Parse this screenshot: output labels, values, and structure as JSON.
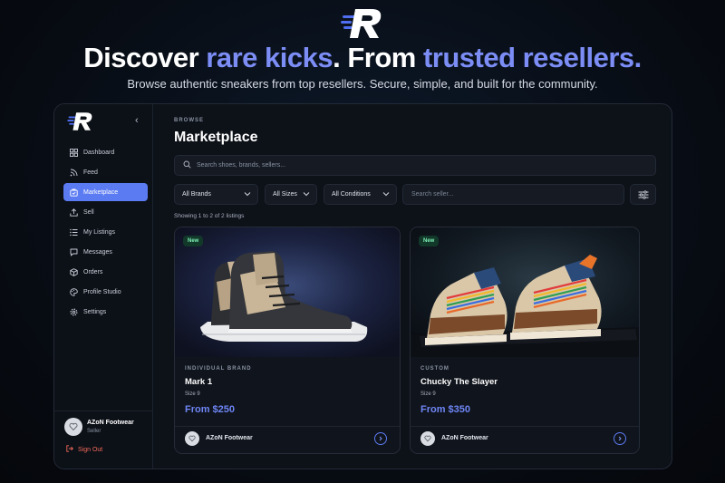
{
  "hero": {
    "title_part1": "Discover ",
    "title_accent1": "rare kicks",
    "title_part2": ". From ",
    "title_accent2": "trusted resellers.",
    "subtitle": "Browse authentic sneakers from top resellers. Secure, simple, and built for the community.",
    "accent_color": "#7c8df6"
  },
  "sidebar": {
    "items": [
      {
        "label": "Dashboard",
        "icon": "grid-icon"
      },
      {
        "label": "Feed",
        "icon": "rss-icon"
      },
      {
        "label": "Marketplace",
        "icon": "shop-icon",
        "active": true
      },
      {
        "label": "Sell",
        "icon": "upload-icon"
      },
      {
        "label": "My Listings",
        "icon": "list-icon"
      },
      {
        "label": "Messages",
        "icon": "chat-icon"
      },
      {
        "label": "Orders",
        "icon": "box-icon"
      },
      {
        "label": "Profile Studio",
        "icon": "palette-icon"
      },
      {
        "label": "Settings",
        "icon": "gear-icon"
      }
    ],
    "user": {
      "name": "AZoN Footwear",
      "role": "Seller"
    },
    "signout_label": "Sign Out"
  },
  "main": {
    "eyebrow": "BROWSE",
    "title": "Marketplace",
    "search_placeholder": "Search shoes, brands, sellers...",
    "filters": {
      "brand": "All Brands",
      "size": "All Sizes",
      "condition": "All Conditions",
      "seller_placeholder": "Search seller..."
    },
    "showing": "Showing 1 to 2 of 2 listings",
    "listings": [
      {
        "badge": "New",
        "category": "INDIVIDUAL BRAND",
        "title": "Mark 1",
        "size": "Size 9",
        "price": "From $250",
        "seller": "AZoN Footwear"
      },
      {
        "badge": "New",
        "category": "CUSTOM",
        "title": "Chucky The Slayer",
        "size": "Size 9",
        "price": "From $350",
        "seller": "AZoN Footwear"
      }
    ]
  },
  "colors": {
    "active_nav": "#5b7bf2",
    "price": "#6e86f6",
    "signout": "#f26a5a",
    "badge_text": "#7df0b4"
  }
}
